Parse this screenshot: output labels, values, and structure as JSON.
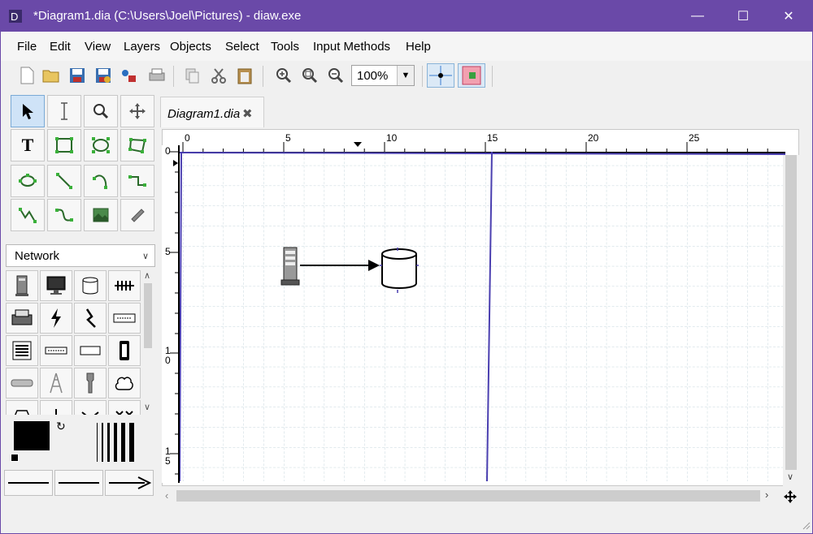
{
  "window": {
    "title": "*Diagram1.dia (C:\\Users\\Joel\\Pictures) - diaw.exe",
    "minimize_icon": "minimize-icon",
    "maximize_icon": "maximize-icon",
    "close_icon": "close-icon"
  },
  "menu": [
    "File",
    "Edit",
    "View",
    "Layers",
    "Objects",
    "Select",
    "Tools",
    "Input Methods",
    "Help"
  ],
  "toolbar": {
    "zoom_value": "100%",
    "icons": [
      "new-icon",
      "open-icon",
      "save-icon",
      "save-as-icon",
      "export-icon",
      "print-icon",
      "copy-icon",
      "cut-icon",
      "paste-icon",
      "zoom-in-icon",
      "zoom-fit-icon",
      "zoom-out-icon",
      "snap-to-grid-icon",
      "snap-to-objects-icon"
    ]
  },
  "toolbox": {
    "tools": [
      "pointer",
      "text-edit",
      "magnify",
      "scroll",
      "text",
      "box",
      "ellipse",
      "polygon",
      "beziergon",
      "line",
      "arc",
      "zigzag-line",
      "polyline",
      "bezier-line",
      "image",
      "outline"
    ],
    "sheet": "Network",
    "shapes": [
      "computer-tower",
      "monitor",
      "storage",
      "bus",
      "printer",
      "lightning",
      "wan-link",
      "modem",
      "rack",
      "hub",
      "flat-terminal",
      "patch-panel",
      "router",
      "antenna",
      "wireless",
      "cloud",
      "firewall",
      "crossroads",
      "switch",
      "bridge"
    ]
  },
  "tab": {
    "label": "Diagram1.dia"
  },
  "rulers": {
    "horizontal": [
      "0",
      "5",
      "10",
      "15",
      "20",
      "25"
    ],
    "vertical": [
      "0",
      "5",
      "1",
      "0",
      "1",
      "5"
    ]
  },
  "colors": {
    "titlebar": "#6a49a8",
    "page_border": "#4a3fb0",
    "grid": "#c4d6dc"
  }
}
